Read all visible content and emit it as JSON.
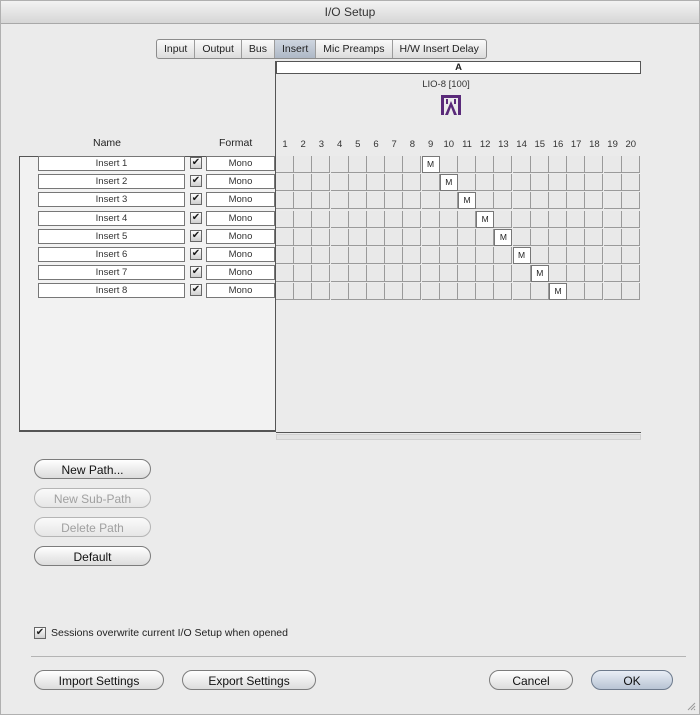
{
  "window": {
    "title": "I/O Setup"
  },
  "tabs": [
    {
      "label": "Input",
      "active": false
    },
    {
      "label": "Output",
      "active": false
    },
    {
      "label": "Bus",
      "active": false
    },
    {
      "label": "Insert",
      "active": true
    },
    {
      "label": "Mic Preamps",
      "active": false
    },
    {
      "label": "H/W Insert Delay",
      "active": false
    }
  ],
  "columns": {
    "name": "Name",
    "format": "Format"
  },
  "bus": {
    "label": "A",
    "device": "LIO-8 [100]",
    "device_icon": "lio8-device-icon"
  },
  "channels": [
    "1",
    "2",
    "3",
    "4",
    "5",
    "6",
    "7",
    "8",
    "9",
    "10",
    "11",
    "12",
    "13",
    "14",
    "15",
    "16",
    "17",
    "18",
    "19",
    "20"
  ],
  "inserts": [
    {
      "name": "Insert 1",
      "enabled": true,
      "format": "Mono",
      "channel": 9,
      "mark": "M"
    },
    {
      "name": "Insert 2",
      "enabled": true,
      "format": "Mono",
      "channel": 10,
      "mark": "M"
    },
    {
      "name": "Insert 3",
      "enabled": true,
      "format": "Mono",
      "channel": 11,
      "mark": "M"
    },
    {
      "name": "Insert 4",
      "enabled": true,
      "format": "Mono",
      "channel": 12,
      "mark": "M"
    },
    {
      "name": "Insert 5",
      "enabled": true,
      "format": "Mono",
      "channel": 13,
      "mark": "M"
    },
    {
      "name": "Insert 6",
      "enabled": true,
      "format": "Mono",
      "channel": 14,
      "mark": "M"
    },
    {
      "name": "Insert 7",
      "enabled": true,
      "format": "Mono",
      "channel": 15,
      "mark": "M"
    },
    {
      "name": "Insert 8",
      "enabled": true,
      "format": "Mono",
      "channel": 16,
      "mark": "M"
    }
  ],
  "path_buttons": {
    "new_path": "New Path...",
    "new_sub_path": "New Sub-Path",
    "delete_path": "Delete Path",
    "default": "Default"
  },
  "sessions_option": {
    "label": "Sessions overwrite current I/O Setup when opened",
    "checked": true,
    "check_glyph": "✔"
  },
  "footer": {
    "import": "Import Settings",
    "export": "Export Settings",
    "cancel": "Cancel",
    "ok": "OK"
  },
  "colors": {
    "assigned_cell": "#ffffff",
    "grid_bg": "#e9e9e9",
    "device_icon": "#5a2a7a"
  }
}
